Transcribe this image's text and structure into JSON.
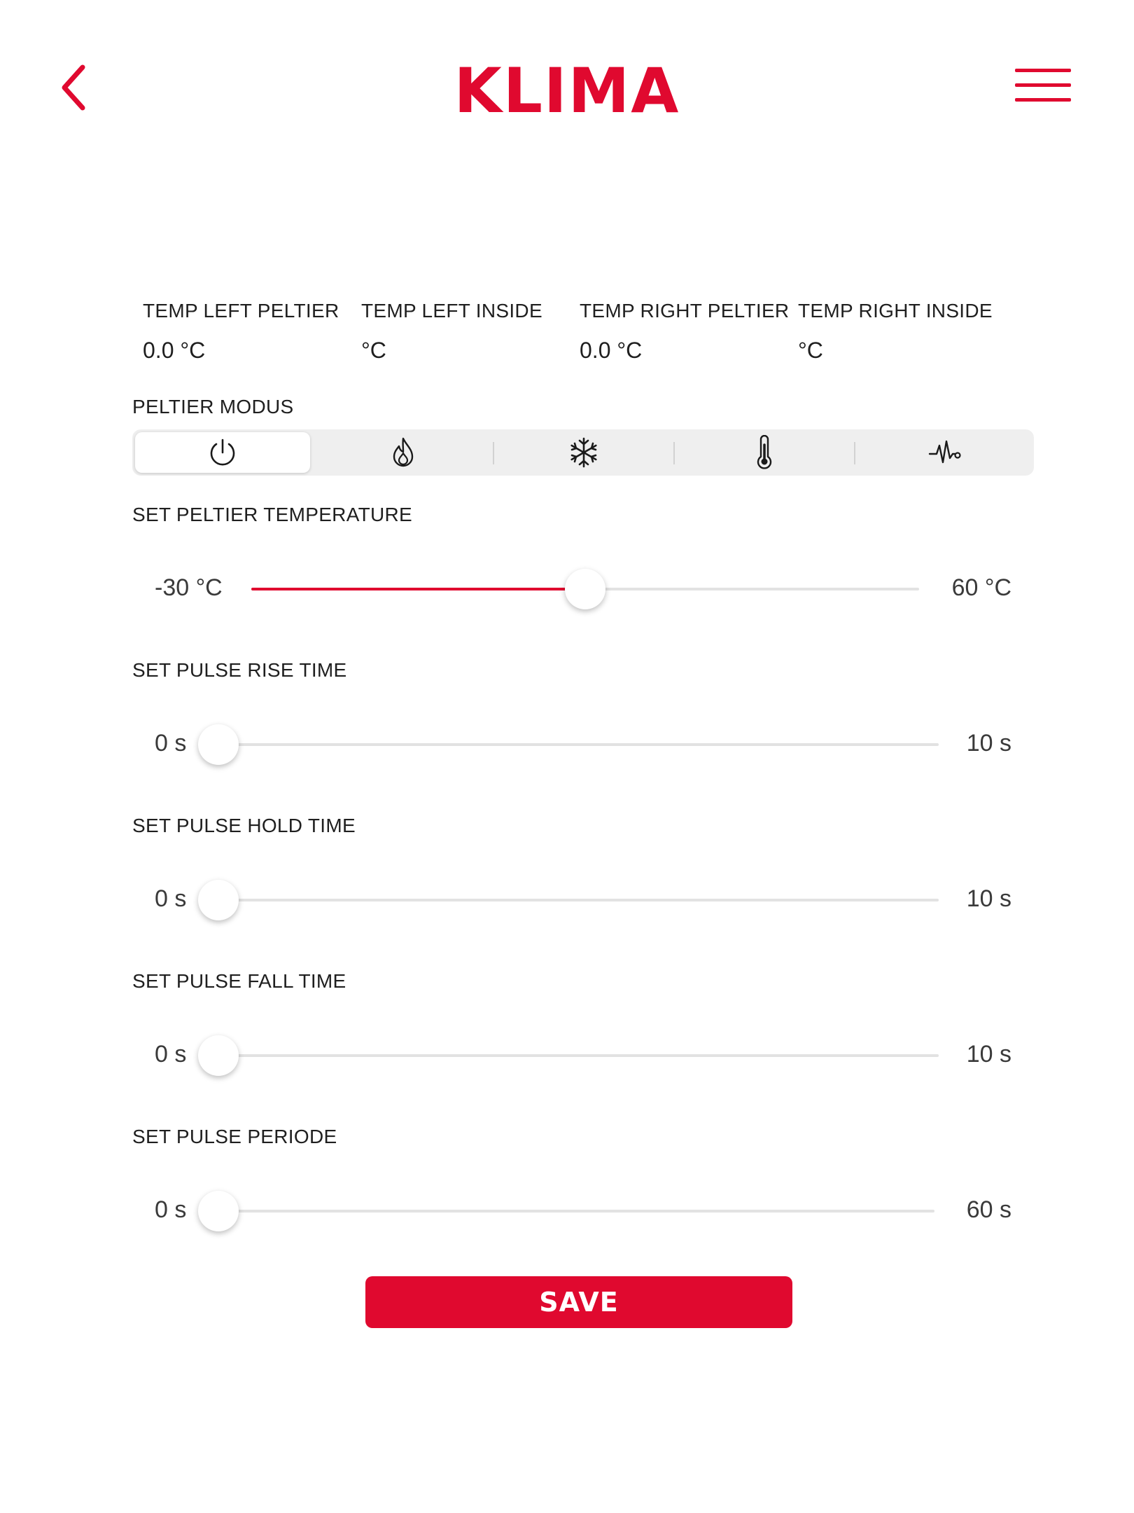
{
  "header": {
    "logo": "KLIMA",
    "back_icon": "chevron-left-icon",
    "menu_icon": "hamburger-menu-icon",
    "accent_color": "#e0092f"
  },
  "temperatures": [
    {
      "label": "TEMP LEFT PELTIER",
      "value": "0.0 °C"
    },
    {
      "label": "TEMP LEFT INSIDE",
      "value": "°C"
    },
    {
      "label": "TEMP RIGHT PELTIER",
      "value": "0.0 °C"
    },
    {
      "label": "TEMP RIGHT INSIDE",
      "value": "°C"
    }
  ],
  "peltier_mode": {
    "label": "PELTIER MODUS",
    "modes": [
      {
        "icon": "power-icon",
        "selected": true
      },
      {
        "icon": "flame-icon",
        "selected": false
      },
      {
        "icon": "snowflake-icon",
        "selected": false
      },
      {
        "icon": "thermometer-icon",
        "selected": false
      },
      {
        "icon": "pulse-icon",
        "selected": false
      }
    ]
  },
  "sliders": [
    {
      "label": "SET PELTIER TEMPERATURE",
      "min_label": "-30 °C",
      "max_label": "60 °C",
      "min": -30,
      "max": 60,
      "value": 15
    },
    {
      "label": "SET PULSE RISE TIME",
      "min_label": "0 s",
      "max_label": "10 s",
      "min": 0,
      "max": 10,
      "value": 0
    },
    {
      "label": "SET PULSE HOLD TIME",
      "min_label": "0 s",
      "max_label": "10 s",
      "min": 0,
      "max": 10,
      "value": 0
    },
    {
      "label": "SET PULSE FALL TIME",
      "min_label": "0 s",
      "max_label": "10 s",
      "min": 0,
      "max": 10,
      "value": 0
    },
    {
      "label": "SET PULSE PERIODE",
      "min_label": "0 s",
      "max_label": "60 s",
      "min": 0,
      "max": 60,
      "value": 0
    }
  ],
  "save_label": "SAVE"
}
